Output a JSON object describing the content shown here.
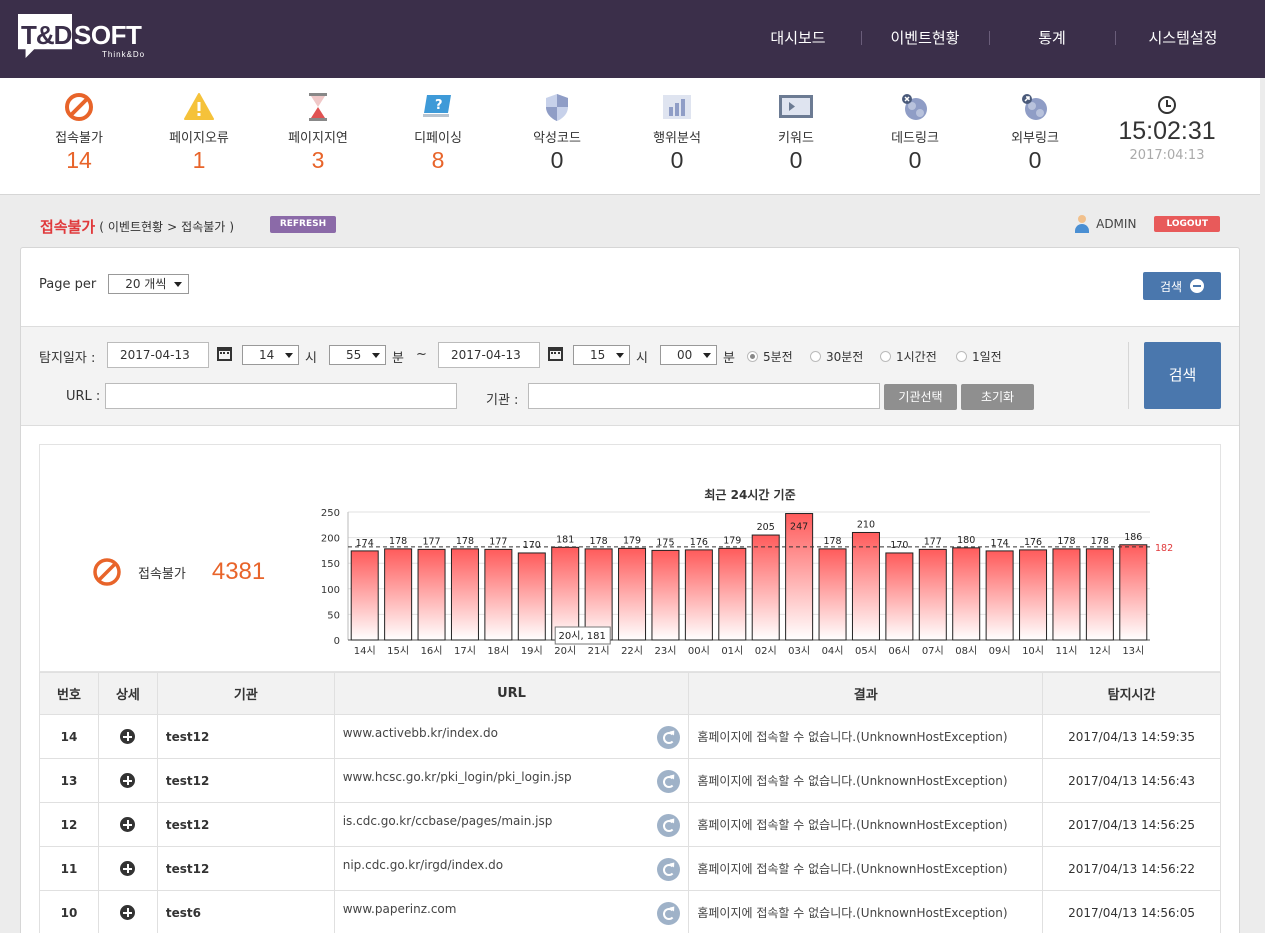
{
  "header": {
    "logo_mark": "T&D",
    "logo_text": "SOFT",
    "logo_tagline": "Think&Do",
    "nav": [
      "대시보드",
      "이벤트현황",
      "통계",
      "시스템설정"
    ]
  },
  "status": [
    {
      "label": "접속불가",
      "value": "14",
      "icon": "prohibited-icon"
    },
    {
      "label": "페이지오류",
      "value": "1",
      "icon": "warning-icon"
    },
    {
      "label": "페이지지연",
      "value": "3",
      "icon": "hourglass-icon"
    },
    {
      "label": "디페이싱",
      "value": "8",
      "icon": "monitor-question-icon"
    },
    {
      "label": "악성코드",
      "value": "0",
      "icon": "shield-icon"
    },
    {
      "label": "행위분석",
      "value": "0",
      "icon": "bar-chart-icon"
    },
    {
      "label": "키워드",
      "value": "0",
      "icon": "video-screen-icon"
    },
    {
      "label": "데드링크",
      "value": "0",
      "icon": "dead-link-icon"
    },
    {
      "label": "외부링크",
      "value": "0",
      "icon": "external-link-icon"
    }
  ],
  "clock": {
    "time": "15:02:31",
    "date": "2017:04:13"
  },
  "breadcrumb": {
    "current": "접속불가",
    "open": "(",
    "path1": "이벤트현황",
    "sep": ">",
    "path2": "접속불가",
    "close": ")"
  },
  "refresh_label": "REFRESH",
  "user": {
    "name": "ADMIN",
    "logout_label": "LOGOUT"
  },
  "search": {
    "page_per_label": "Page per",
    "page_per_value": "20 개씩",
    "toggle_label": "검색",
    "date_label": "탐지일자 :",
    "start_date": "2017-04-13",
    "start_hour": "14",
    "hour_unit": "시",
    "start_min": "55",
    "min_unit": "분",
    "range_sep": "~",
    "end_date": "2017-04-13",
    "end_hour": "15",
    "end_min": "00",
    "radios": [
      "5분전",
      "30분전",
      "1시간전",
      "1일전"
    ],
    "selected_radio": "5분전",
    "url_label": "URL :",
    "url_value": "",
    "org_label": "기관 :",
    "org_value": "",
    "org_select_btn": "기관선택",
    "reset_btn": "초기화",
    "search_btn": "검색"
  },
  "summary": {
    "label": "접속불가",
    "total": "4381"
  },
  "chart_data": {
    "type": "bar",
    "title": "최근 24시간 기준",
    "categories": [
      "14시",
      "15시",
      "16시",
      "17시",
      "18시",
      "19시",
      "20시",
      "21시",
      "22시",
      "23시",
      "00시",
      "01시",
      "02시",
      "03시",
      "04시",
      "05시",
      "06시",
      "07시",
      "08시",
      "09시",
      "10시",
      "11시",
      "12시",
      "13시"
    ],
    "values": [
      174,
      178,
      177,
      178,
      177,
      170,
      181,
      178,
      179,
      175,
      176,
      179,
      205,
      247,
      178,
      210,
      170,
      177,
      180,
      174,
      176,
      178,
      178,
      186
    ],
    "average": 182,
    "average_label": "182",
    "ylim": [
      0,
      250
    ],
    "yticks": [
      0,
      50,
      100,
      150,
      200,
      250
    ],
    "grid": true,
    "tooltip": "20시, 181",
    "bar_color": "#ff5b5b"
  },
  "table": {
    "columns": [
      "번호",
      "상세",
      "기관",
      "URL",
      "결과",
      "탐지시간"
    ],
    "rows": [
      {
        "no": "14",
        "org": "test12",
        "url": "www.activebb.kr/index.do",
        "result": "홈페이지에 접속할 수 없습니다.(UnknownHostException)",
        "time": "2017/04/13 14:59:35"
      },
      {
        "no": "13",
        "org": "test12",
        "url": "www.hcsc.go.kr/pki_login/pki_login.jsp",
        "result": "홈페이지에 접속할 수 없습니다.(UnknownHostException)",
        "time": "2017/04/13 14:56:43"
      },
      {
        "no": "12",
        "org": "test12",
        "url": "is.cdc.go.kr/ccbase/pages/main.jsp",
        "result": "홈페이지에 접속할 수 없습니다.(UnknownHostException)",
        "time": "2017/04/13 14:56:25"
      },
      {
        "no": "11",
        "org": "test12",
        "url": "nip.cdc.go.kr/irgd/index.do",
        "result": "홈페이지에 접속할 수 없습니다.(UnknownHostException)",
        "time": "2017/04/13 14:56:22"
      },
      {
        "no": "10",
        "org": "test6",
        "url": "www.paperinz.com",
        "result": "홈페이지에 접속할 수 없습니다.(UnknownHostException)",
        "time": "2017/04/13 14:56:05"
      }
    ]
  }
}
